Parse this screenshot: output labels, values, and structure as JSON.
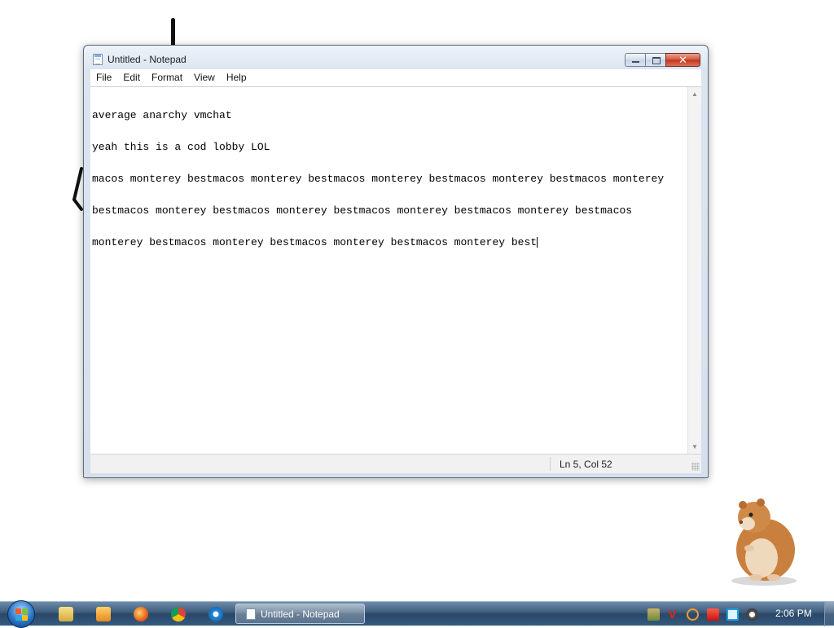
{
  "window": {
    "title": "Untitled - Notepad",
    "close_glyph": "✕"
  },
  "menu": {
    "items": [
      "File",
      "Edit",
      "Format",
      "View",
      "Help"
    ]
  },
  "editor": {
    "lines": [
      "average anarchy vmchat",
      "yeah this is a cod lobby LOL",
      "macos monterey bestmacos monterey bestmacos monterey bestmacos monterey bestmacos monterey",
      "bestmacos monterey bestmacos monterey bestmacos monterey bestmacos monterey bestmacos",
      "monterey bestmacos monterey bestmacos monterey bestmacos monterey best"
    ],
    "scroll_up_glyph": "▲",
    "scroll_down_glyph": "▼"
  },
  "status": {
    "position": "Ln 5, Col 52"
  },
  "taskbar": {
    "pinned_icons": [
      "windows-explorer-icon",
      "media-player-icon",
      "firefox-icon",
      "chrome-icon",
      "internet-explorer-icon"
    ],
    "active_task_label": "Untitled - Notepad",
    "tray_icons": [
      "game-icon",
      "v-icon",
      "search-tray-icon",
      "flag-icon",
      "network-icon",
      "volume-icon"
    ],
    "clock": "2:06 PM"
  },
  "colors": {
    "taskbar": "#2a4766",
    "close_button": "#c2331b",
    "title_text": "#1e1e1e"
  }
}
